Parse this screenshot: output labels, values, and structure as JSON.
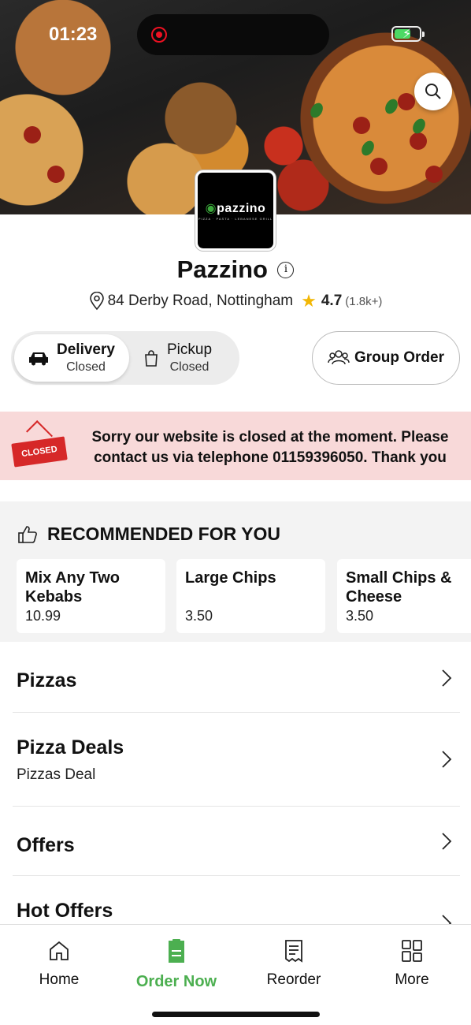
{
  "status_bar": {
    "time": "01:23"
  },
  "restaurant": {
    "logo_text": "pazzino",
    "logo_tagline": "PIZZA · PASTA · LEBANESE GRILL",
    "name": "Pazzino",
    "address": "84 Derby Road, Nottingham",
    "rating": "4.7",
    "rating_count": "(1.8k+)"
  },
  "order_modes": [
    {
      "label": "Delivery",
      "status": "Closed",
      "selected": true
    },
    {
      "label": "Pickup",
      "status": "Closed",
      "selected": false
    }
  ],
  "group_order": {
    "label": "Group Order"
  },
  "closed_banner": {
    "sign_text": "CLOSED",
    "message": "Sorry our website is closed at the moment. Please contact us via telephone 01159396050. Thank you"
  },
  "recommended": {
    "heading": "RECOMMENDED FOR YOU",
    "items": [
      {
        "name": "Mix Any Two Kebabs",
        "price": "10.99"
      },
      {
        "name": "Large Chips",
        "price": "3.50"
      },
      {
        "name": "Small Chips & Cheese",
        "price": "3.50"
      }
    ]
  },
  "categories": [
    {
      "name": "Pizzas",
      "subtitle": ""
    },
    {
      "name": "Pizza Deals",
      "subtitle": "Pizzas Deal"
    },
    {
      "name": "Offers",
      "subtitle": ""
    },
    {
      "name": "Hot Offers",
      "subtitle": ""
    }
  ],
  "tab_bar": {
    "accent_color": "#4caf50",
    "tabs": [
      {
        "label": "Home",
        "icon": "home-icon"
      },
      {
        "label": "Order Now",
        "icon": "order-icon",
        "active": true
      },
      {
        "label": "Reorder",
        "icon": "receipt-icon"
      },
      {
        "label": "More",
        "icon": "grid-icon"
      }
    ]
  }
}
